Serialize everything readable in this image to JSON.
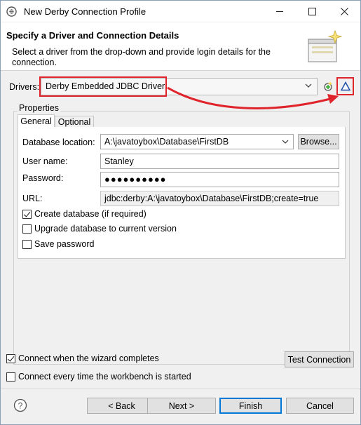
{
  "window": {
    "title": "New Derby Connection Profile",
    "minimize_icon": "minimize-icon",
    "maximize_icon": "maximize-icon",
    "close_icon": "close-icon"
  },
  "header": {
    "title": "Specify a Driver and Connection Details",
    "description": "Select a driver from the drop-down and provide login details for the connection."
  },
  "drivers": {
    "label": "Drivers:",
    "selected": "Derby Embedded JDBC Driver"
  },
  "properties": {
    "label": "Properties",
    "tabs": [
      {
        "label": "General",
        "active": true
      },
      {
        "label": "Optional",
        "active": false
      }
    ],
    "general": {
      "db_location_label": "Database location:",
      "db_location_value": "A:\\javatoybox\\Database\\FirstDB",
      "browse_label": "Browse...",
      "user_label": "User name:",
      "user_value": "Stanley",
      "password_label": "Password:",
      "password_value": "●●●●●●●●●●",
      "url_label": "URL:",
      "url_value": "jdbc:derby:A:\\javatoybox\\Database\\FirstDB;create=true",
      "create_db_label": "Create database (if required)",
      "create_db_checked": true,
      "upgrade_db_label": "Upgrade database to current version",
      "upgrade_db_checked": false,
      "save_password_label": "Save password",
      "save_password_checked": false
    }
  },
  "options": {
    "connect_on_finish_label": "Connect when the wizard completes",
    "connect_on_finish_checked": true,
    "connect_every_time_label": "Connect every time the workbench is started",
    "connect_every_time_checked": false,
    "test_connection_label": "Test Connection"
  },
  "footer": {
    "back_label": "< Back",
    "next_label": "Next >",
    "finish_label": "Finish",
    "cancel_label": "Cancel"
  },
  "colors": {
    "annotation_red": "#e0242b",
    "primary_border": "#0078d7"
  }
}
